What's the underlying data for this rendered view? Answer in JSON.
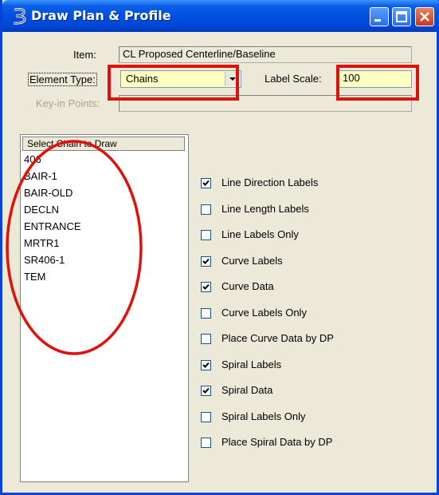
{
  "window": {
    "title": "Draw Plan & Profile",
    "icon": "chain-icon"
  },
  "form": {
    "item_label": "Item:",
    "item_value": "CL Proposed Centerline/Baseline",
    "element_type_label": "Element Type:",
    "element_type_value": "Chains",
    "label_scale_label": "Label Scale:",
    "label_scale_value": "100",
    "keyin_label": "Key-in Points:",
    "keyin_value": ""
  },
  "chain_list": {
    "header": "Select Chain to Draw",
    "items": [
      "406",
      "BAIR-1",
      "BAIR-OLD",
      "DECLN",
      "ENTRANCE",
      "MRTR1",
      "SR406-1",
      "TEM"
    ]
  },
  "options": [
    {
      "label": "Line Direction Labels",
      "checked": true
    },
    {
      "label": "Line Length Labels",
      "checked": false
    },
    {
      "label": "Line Labels Only",
      "checked": false
    },
    {
      "label": "Curve Labels",
      "checked": true
    },
    {
      "label": "Curve Data",
      "checked": true
    },
    {
      "label": "Curve Labels Only",
      "checked": false
    },
    {
      "label": "Place Curve Data by DP",
      "checked": false
    },
    {
      "label": "Spiral Labels",
      "checked": true
    },
    {
      "label": "Spiral Data",
      "checked": true
    },
    {
      "label": "Spiral Labels Only",
      "checked": false
    },
    {
      "label": "Place Spiral Data by DP",
      "checked": false
    }
  ],
  "colors": {
    "titlebar": "#0050e0",
    "highlight_red": "#e0100a",
    "combo_bg": "#ffffc0",
    "dialog_bg": "#ece9d8"
  }
}
